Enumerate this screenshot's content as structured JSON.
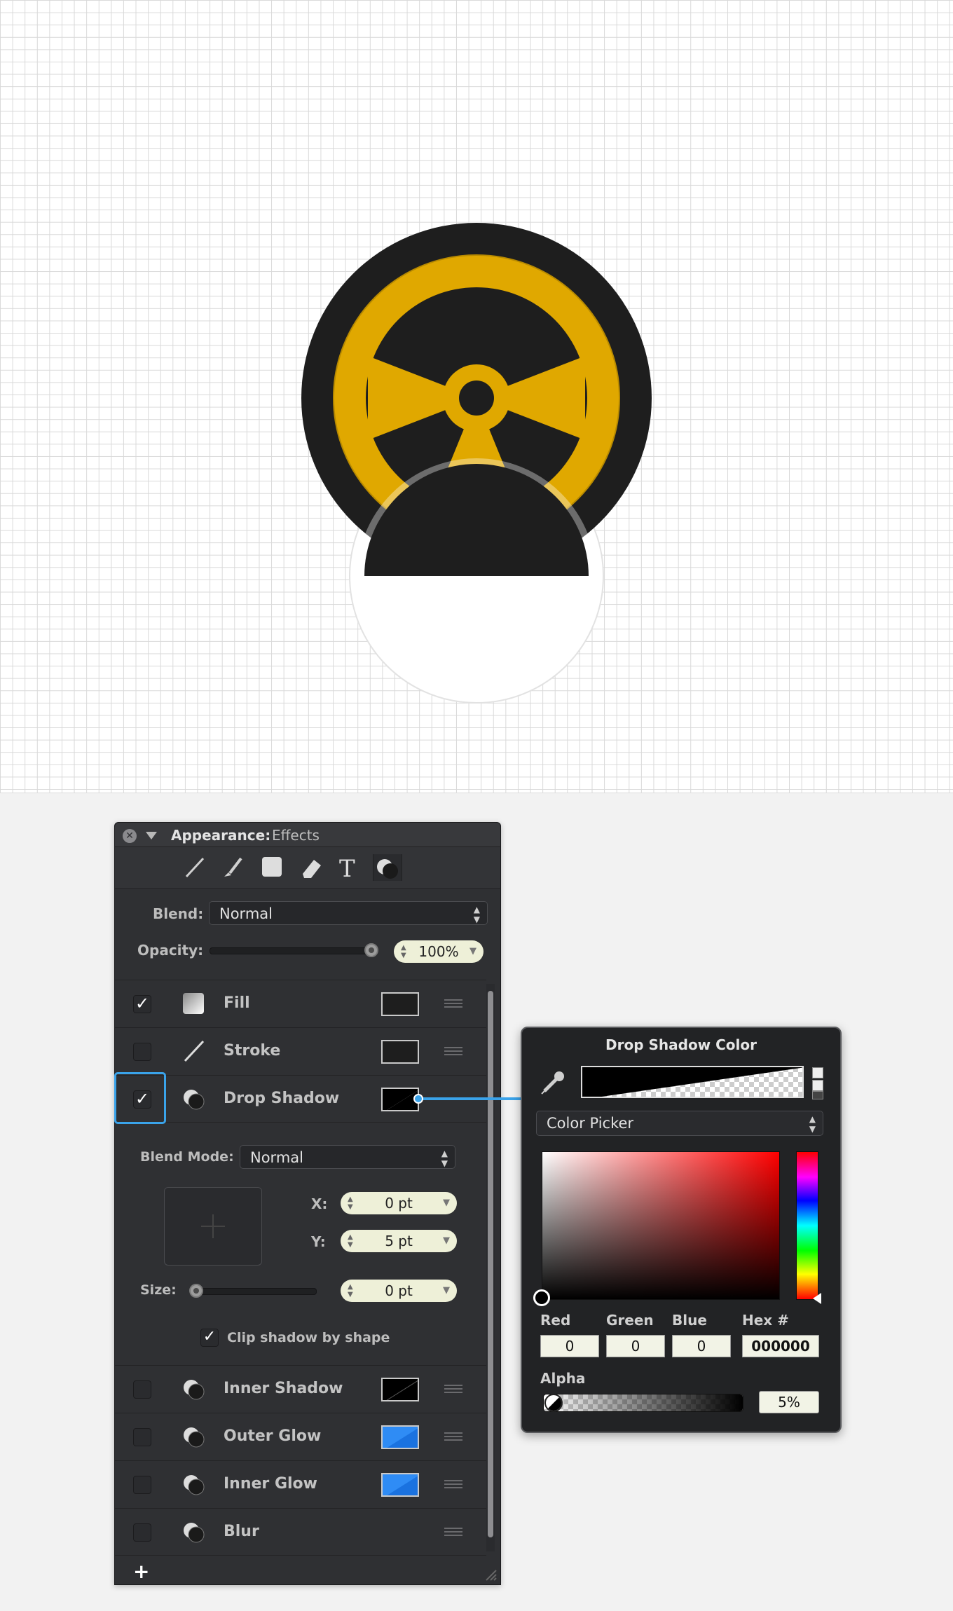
{
  "panel": {
    "title": "Appearance:",
    "subtitle": "Effects",
    "blend_label": "Blend:",
    "blend_value": "Normal",
    "opacity_label": "Opacity:",
    "opacity_value": "100%",
    "opacity_level": 1.0,
    "rows": {
      "fill": {
        "label": "Fill",
        "checked": true
      },
      "stroke": {
        "label": "Stroke",
        "checked": false
      },
      "drop_shadow": {
        "label": "Drop Shadow",
        "checked": true
      },
      "inner_shadow": {
        "label": "Inner Shadow",
        "checked": false
      },
      "outer_glow": {
        "label": "Outer Glow",
        "checked": false
      },
      "inner_glow": {
        "label": "Inner Glow",
        "checked": false
      },
      "blur": {
        "label": "Blur",
        "checked": false
      }
    },
    "shadow": {
      "blend_mode_label": "Blend Mode:",
      "blend_mode_value": "Normal",
      "x_label": "X:",
      "x_value": "0 pt",
      "y_label": "Y:",
      "y_value": "5 pt",
      "size_label": "Size:",
      "size_value": "0 pt",
      "clip_label": "Clip shadow by shape",
      "clip_checked": true
    },
    "add_glyph": "+",
    "check_glyph": "✓"
  },
  "color_picker": {
    "title": "Drop Shadow Color",
    "mode_value": "Color Picker",
    "red_label": "Red",
    "green_label": "Green",
    "blue_label": "Blue",
    "hex_label": "Hex #",
    "red_value": "0",
    "green_value": "0",
    "blue_value": "0",
    "hex_value": "000000",
    "alpha_label": "Alpha",
    "alpha_value": "5%"
  },
  "colors": {
    "icon_yellow": "#e0a800",
    "icon_dark": "#1e1e1e",
    "highlight_blue": "#3aa3ea",
    "glow_blue": "#2f8cf5"
  }
}
